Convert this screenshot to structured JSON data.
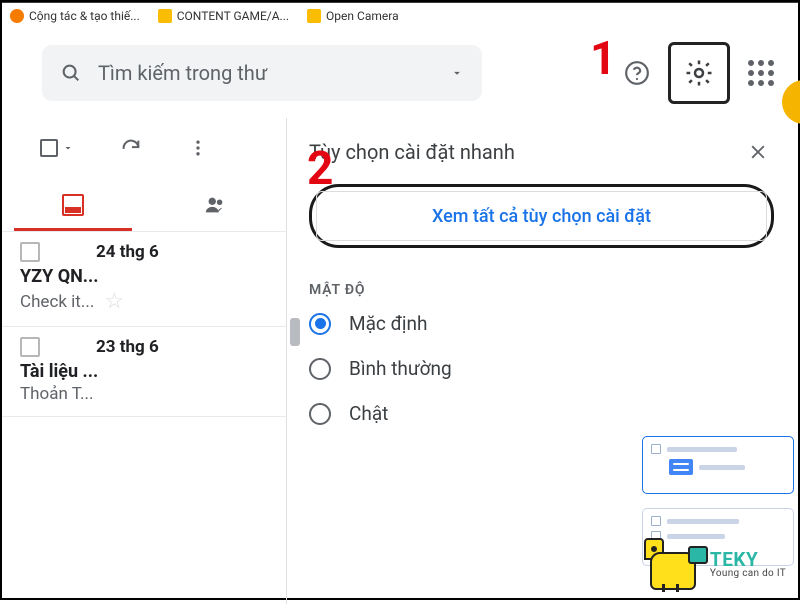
{
  "bookmarks": [
    {
      "label": "Cộng tác & tạo thiế...",
      "color": "#f57c00"
    },
    {
      "label": "CONTENT GAME/A...",
      "color": "#fbbc04"
    },
    {
      "label": "Open Camera",
      "color": "#fbbc04"
    }
  ],
  "search": {
    "placeholder": "Tìm kiếm trong thư"
  },
  "annotations": {
    "one": "1",
    "two": "2"
  },
  "mail_tabs": {
    "primary": "primary",
    "social": "social"
  },
  "mails": [
    {
      "date": "24 thg 6",
      "sender": "YZY QN...",
      "subject": "Check it..."
    },
    {
      "date": "23 thg 6",
      "sender": "Tài liệu ...",
      "subject": "Thoản T..."
    }
  ],
  "panel": {
    "title": "Tùy chọn cài đặt nhanh",
    "see_all": "Xem tất cả tùy chọn cài đặt",
    "density_label": "MẬT ĐỘ",
    "density_options": [
      {
        "label": "Mặc định",
        "selected": true
      },
      {
        "label": "Bình thường",
        "selected": false
      },
      {
        "label": "Chật",
        "selected": false
      }
    ]
  },
  "brand": {
    "name": "TEKY",
    "tagline": "Young can do IT"
  }
}
